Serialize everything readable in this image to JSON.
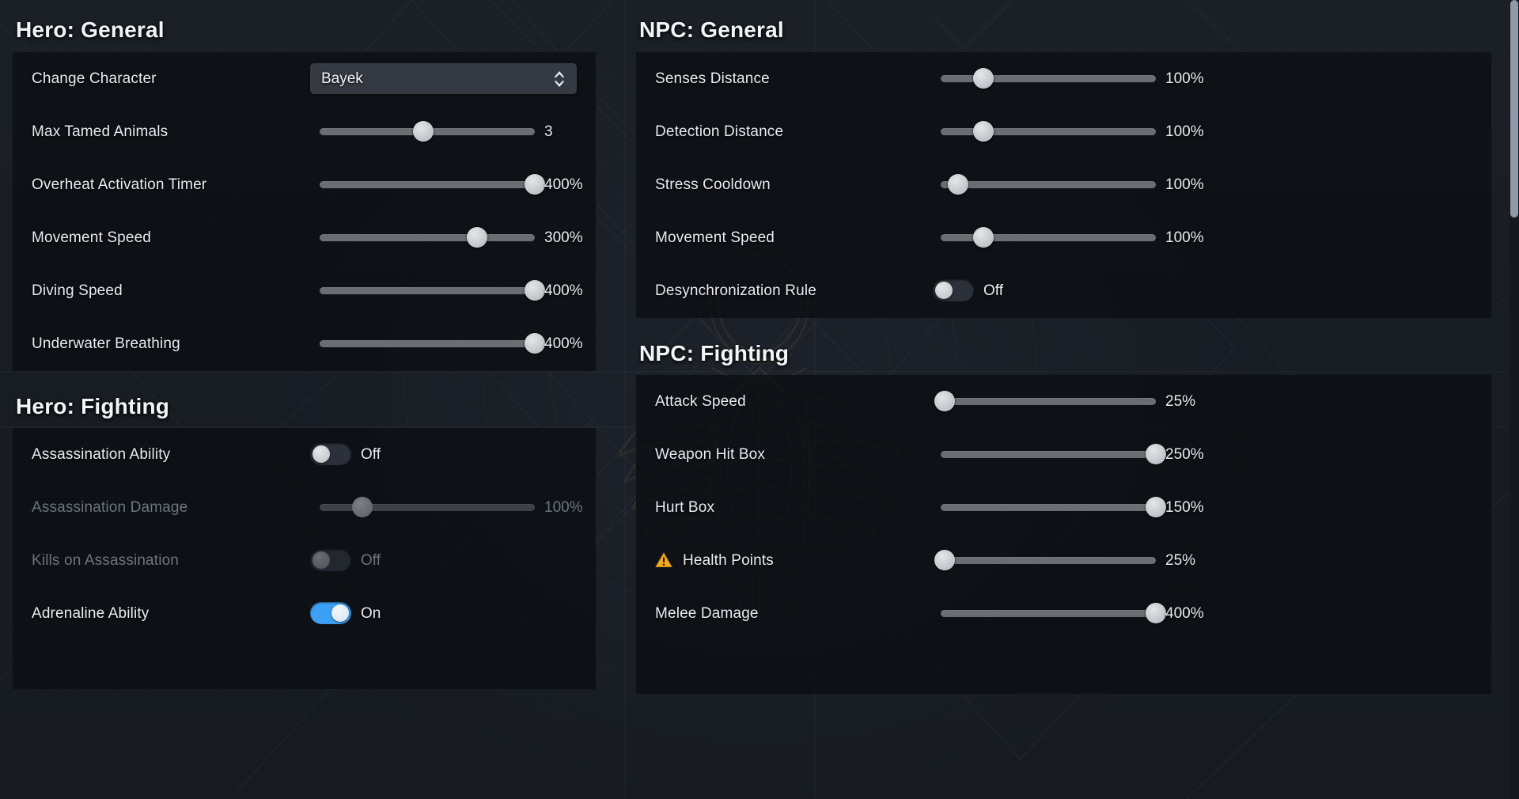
{
  "sections": [
    {
      "id": "hero-general",
      "title": "Hero: General",
      "rows": [
        {
          "label": "Change Character",
          "control": "dropdown",
          "value": "Bayek",
          "disabled": false
        },
        {
          "label": "Max Tamed Animals",
          "control": "slider",
          "value": "3",
          "fill": 48,
          "disabled": false
        },
        {
          "label": "Overheat Activation Timer",
          "control": "slider",
          "value": "400%",
          "fill": 100,
          "disabled": false
        },
        {
          "label": "Movement Speed",
          "control": "slider",
          "value": "300%",
          "fill": 73,
          "disabled": false
        },
        {
          "label": "Diving Speed",
          "control": "slider",
          "value": "400%",
          "fill": 100,
          "disabled": false
        },
        {
          "label": "Underwater Breathing",
          "control": "slider",
          "value": "400%",
          "fill": 100,
          "disabled": false
        }
      ]
    },
    {
      "id": "hero-fighting",
      "title": "Hero: Fighting",
      "rows": [
        {
          "label": "Assassination Ability",
          "control": "toggle",
          "value": "Off",
          "on": false,
          "disabled": false
        },
        {
          "label": "Assassination Damage",
          "control": "slider",
          "value": "100%",
          "fill": 20,
          "disabled": true
        },
        {
          "label": "Kills on Assassination",
          "control": "toggle",
          "value": "Off",
          "on": false,
          "disabled": true
        },
        {
          "label": "Adrenaline Ability",
          "control": "toggle",
          "value": "On",
          "on": true,
          "disabled": false
        }
      ]
    },
    {
      "id": "npc-general",
      "title": "NPC: General",
      "rows": [
        {
          "label": "Senses Distance",
          "control": "slider",
          "value": "100%",
          "fill": 20,
          "disabled": false
        },
        {
          "label": "Detection Distance",
          "control": "slider",
          "value": "100%",
          "fill": 20,
          "disabled": false
        },
        {
          "label": "Stress Cooldown",
          "control": "slider",
          "value": "100%",
          "fill": 8,
          "disabled": false
        },
        {
          "label": "Movement Speed",
          "control": "slider",
          "value": "100%",
          "fill": 20,
          "disabled": false
        },
        {
          "label": "Desynchronization Rule",
          "control": "toggle",
          "value": "Off",
          "on": false,
          "disabled": false
        }
      ]
    },
    {
      "id": "npc-fighting",
      "title": "NPC: Fighting",
      "rows": [
        {
          "label": "Attack Speed",
          "control": "slider",
          "value": "25%",
          "fill": 2,
          "disabled": false
        },
        {
          "label": "Weapon Hit Box",
          "control": "slider",
          "value": "250%",
          "fill": 100,
          "disabled": false
        },
        {
          "label": "Hurt Box",
          "control": "slider",
          "value": "150%",
          "fill": 100,
          "disabled": false
        },
        {
          "label": "Health Points",
          "control": "slider",
          "value": "25%",
          "fill": 2,
          "disabled": false,
          "warning": true
        },
        {
          "label": "Melee Damage",
          "control": "slider",
          "value": "400%",
          "fill": 100,
          "disabled": false
        }
      ]
    }
  ],
  "icons": {
    "warning": "warning-triangle-icon",
    "stepper": "stepper-arrows-icon",
    "scrollbar": "vertical-scrollbar"
  },
  "colors": {
    "accent_on": "#3da0f5",
    "warning": "#f0ab22",
    "panel_bg": "#0b0e12",
    "page_bg": "#1b2027",
    "text": "#e9ecf1",
    "text_disabled": "#6e747e",
    "track": "#6a6d72",
    "thumb": "#c4c7cb"
  }
}
